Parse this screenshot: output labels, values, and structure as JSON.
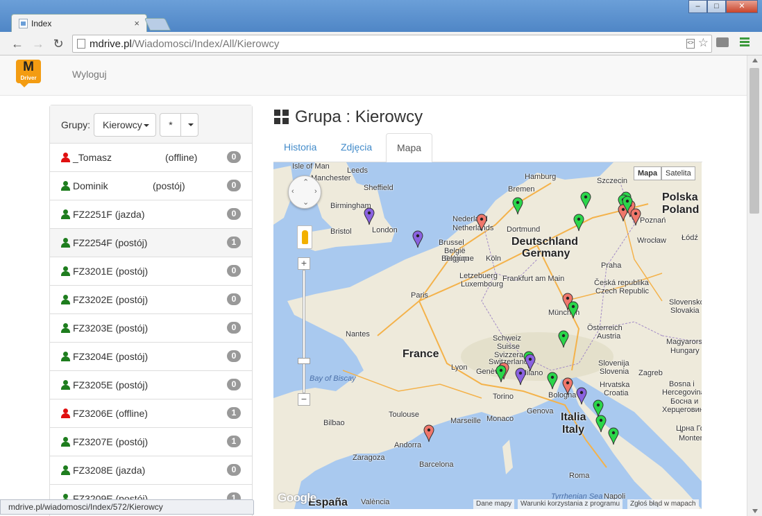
{
  "browser": {
    "tab_title": "Index",
    "tab_close": "×",
    "url_host": "mdrive.pl",
    "url_path": "/Wiadomosci/Index/All/Kierowcy",
    "status_url": "mdrive.pl/wiadomosci/Index/572/Kierowcy",
    "win_minimize": "–",
    "win_maximize": "□",
    "win_close": "✕"
  },
  "navbar": {
    "logo_letter": "M",
    "logo_sub": "Driver",
    "logout_label": "Wyloguj"
  },
  "sidebar": {
    "groups_label": "Grupy:",
    "group_selected": "Kierowcy",
    "filter_selected": "*",
    "users": [
      {
        "name": "_Tomasz",
        "status": "(offline)",
        "count": "0",
        "color": "red",
        "status_sep": true
      },
      {
        "name": "Dominik",
        "status": "(postój)",
        "count": "0",
        "color": "green",
        "status_sep": true
      },
      {
        "name": "FZ2251F (jazda)",
        "status": "",
        "count": "0",
        "color": "green"
      },
      {
        "name": "FZ2254F (postój)",
        "status": "",
        "count": "1",
        "color": "green",
        "selected": true
      },
      {
        "name": "FZ3201E (postój)",
        "status": "",
        "count": "0",
        "color": "green"
      },
      {
        "name": "FZ3202E (postój)",
        "status": "",
        "count": "0",
        "color": "green"
      },
      {
        "name": "FZ3203E (postój)",
        "status": "",
        "count": "0",
        "color": "green"
      },
      {
        "name": "FZ3204E (postój)",
        "status": "",
        "count": "0",
        "color": "green"
      },
      {
        "name": "FZ3205E (postój)",
        "status": "",
        "count": "0",
        "color": "green"
      },
      {
        "name": "FZ3206E (offline)",
        "status": "",
        "count": "1",
        "color": "red"
      },
      {
        "name": "FZ3207E (postój)",
        "status": "",
        "count": "1",
        "color": "green"
      },
      {
        "name": "FZ3208E (jazda)",
        "status": "",
        "count": "0",
        "color": "green"
      },
      {
        "name": "FZ3209E (postój)",
        "status": "",
        "count": "1",
        "color": "green"
      }
    ]
  },
  "main": {
    "heading": "Grupa : Kierowcy",
    "tabs": [
      {
        "label": "Historia",
        "active": false
      },
      {
        "label": "Zdjęcia",
        "active": false
      },
      {
        "label": "Mapa",
        "active": true
      }
    ]
  },
  "map": {
    "type_map": "Mapa",
    "type_satellite": "Satelita",
    "google_logo": "Google",
    "footer_data": "Dane mapy",
    "footer_terms": "Warunki korzystania z programu",
    "footer_report": "Zgłoś błąd w mapach",
    "zoom_in": "+",
    "zoom_out": "−",
    "labels": [
      "Isle of Man",
      "Leeds",
      "Manchester",
      "Sheffield",
      "Birmingham",
      "Bristol",
      "London",
      "Hamburg",
      "Bremen",
      "Szczecin",
      "Polska",
      "Poland",
      "Nederland",
      "Netherlands",
      "Dortmund",
      "Deutschland",
      "Germany",
      "Poznań",
      "Wrocław",
      "Łódź",
      "Brussel",
      "België",
      "Belgique",
      "Belgium",
      "Köln",
      "Letzebuerg",
      "Luxembourg",
      "Frankfurt am Main",
      "Praha",
      "Česká republika",
      "Czech Republic",
      "Slovensko",
      "Slovakia",
      "Paris",
      "München",
      "Österreich",
      "Austria",
      "Magyarors",
      "Hungary",
      "Nantes",
      "Schweiz",
      "Suisse",
      "Svizzera",
      "Switzerland",
      "Slovenija",
      "Slovenia",
      "France",
      "Lyon",
      "Genève",
      "Milano",
      "Zagreb",
      "Hrvatska",
      "Croatia",
      "Bay of Biscay",
      "Torino",
      "Bologna",
      "Bosna i",
      "Hercegovina",
      "Босна и",
      "Херцеговина",
      "Bilbao",
      "Toulouse",
      "Marseille",
      "Monaco",
      "Genova",
      "Italia",
      "Italy",
      "Црна Гора",
      "Montenegro",
      "Andorra",
      "Zaragoza",
      "Barcelona",
      "Roma",
      "Napoli",
      "España",
      "València",
      "Tyrrhenian Sea"
    ]
  },
  "colors": {
    "pin_red": "#f0776b",
    "pin_green": "#2bd64a",
    "pin_purple": "#8a62e0",
    "link": "#428bca",
    "logo": "#f39c12"
  }
}
